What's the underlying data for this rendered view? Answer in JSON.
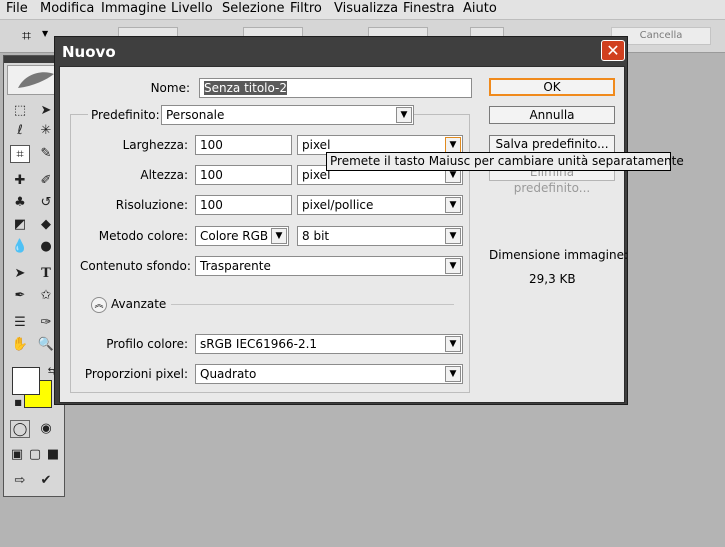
{
  "menubar": [
    "File",
    "Modifica",
    "Immagine",
    "Livello",
    "Selezione",
    "Filtro",
    "Visualizza",
    "Finestra",
    "Aiuto"
  ],
  "options_bar": {
    "tool_icon": "crop-icon",
    "cancel_label": "Cancella"
  },
  "toolbox": {
    "tools": [
      "marquee-icon",
      "move-icon",
      "lasso-icon",
      "magic-wand-icon",
      "crop-icon",
      "slice-icon",
      "healing-brush-icon",
      "brush-icon",
      "clone-stamp-icon",
      "history-brush-icon",
      "eraser-icon",
      "paint-bucket-icon",
      "blur-icon",
      "dodge-icon",
      "path-selection-icon",
      "type-icon",
      "pen-icon",
      "shape-icon",
      "notes-icon",
      "eyedropper-icon",
      "hand-icon",
      "zoom-icon"
    ],
    "foreground_color": "#ffffff",
    "background_color": "#ffff00"
  },
  "dialog": {
    "title": "Nuovo",
    "name_label": "Nome:",
    "name_value": "Senza titolo-2",
    "preset_label": "Predefinito:",
    "preset_value": "Personale",
    "width_label": "Larghezza:",
    "width_value": "100",
    "width_unit": "pixel",
    "height_label": "Altezza:",
    "height_value": "100",
    "height_unit": "pixel",
    "resolution_label": "Risoluzione:",
    "resolution_value": "100",
    "resolution_unit": "pixel/pollice",
    "color_mode_label": "Metodo colore:",
    "color_mode_value": "Colore RGB",
    "bit_depth_value": "8 bit",
    "background_label": "Contenuto sfondo:",
    "background_value": "Trasparente",
    "advanced_label": "Avanzate",
    "color_profile_label": "Profilo colore:",
    "color_profile_value": "sRGB IEC61966-2.1",
    "pixel_aspect_label": "Proporzioni pixel:",
    "pixel_aspect_value": "Quadrato",
    "ok_label": "OK",
    "cancel_label": "Annulla",
    "save_preset_label": "Salva predefinito...",
    "delete_preset_label": "Elimina predefinito...",
    "image_size_label": "Dimensione immagine:",
    "image_size_value": "29,3 KB",
    "tooltip": "Premete il tasto Maiusc per cambiare unità separatamente"
  }
}
